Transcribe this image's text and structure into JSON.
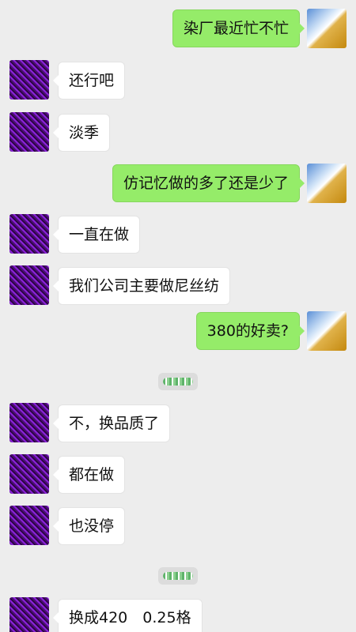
{
  "messages": [
    {
      "side": "me",
      "text": "染厂最近忙不忙"
    },
    {
      "side": "them",
      "text": "还行吧"
    },
    {
      "side": "them",
      "text": "淡季"
    },
    {
      "side": "me",
      "text": "仿记忆做的多了还是少了"
    },
    {
      "side": "them",
      "text": "一直在做"
    },
    {
      "side": "them",
      "text": "我们公司主要做尼丝纺"
    },
    {
      "side": "me",
      "text": "380的好卖?"
    },
    {
      "side": "them",
      "text": "不，换品质了"
    },
    {
      "side": "them",
      "text": "都在做"
    },
    {
      "side": "them",
      "text": "也没停"
    },
    {
      "side": "them",
      "text": "换成420　0.25格"
    }
  ],
  "colors": {
    "background": "#ededed",
    "my_bubble": "#95ec69",
    "their_bubble": "#ffffff"
  }
}
